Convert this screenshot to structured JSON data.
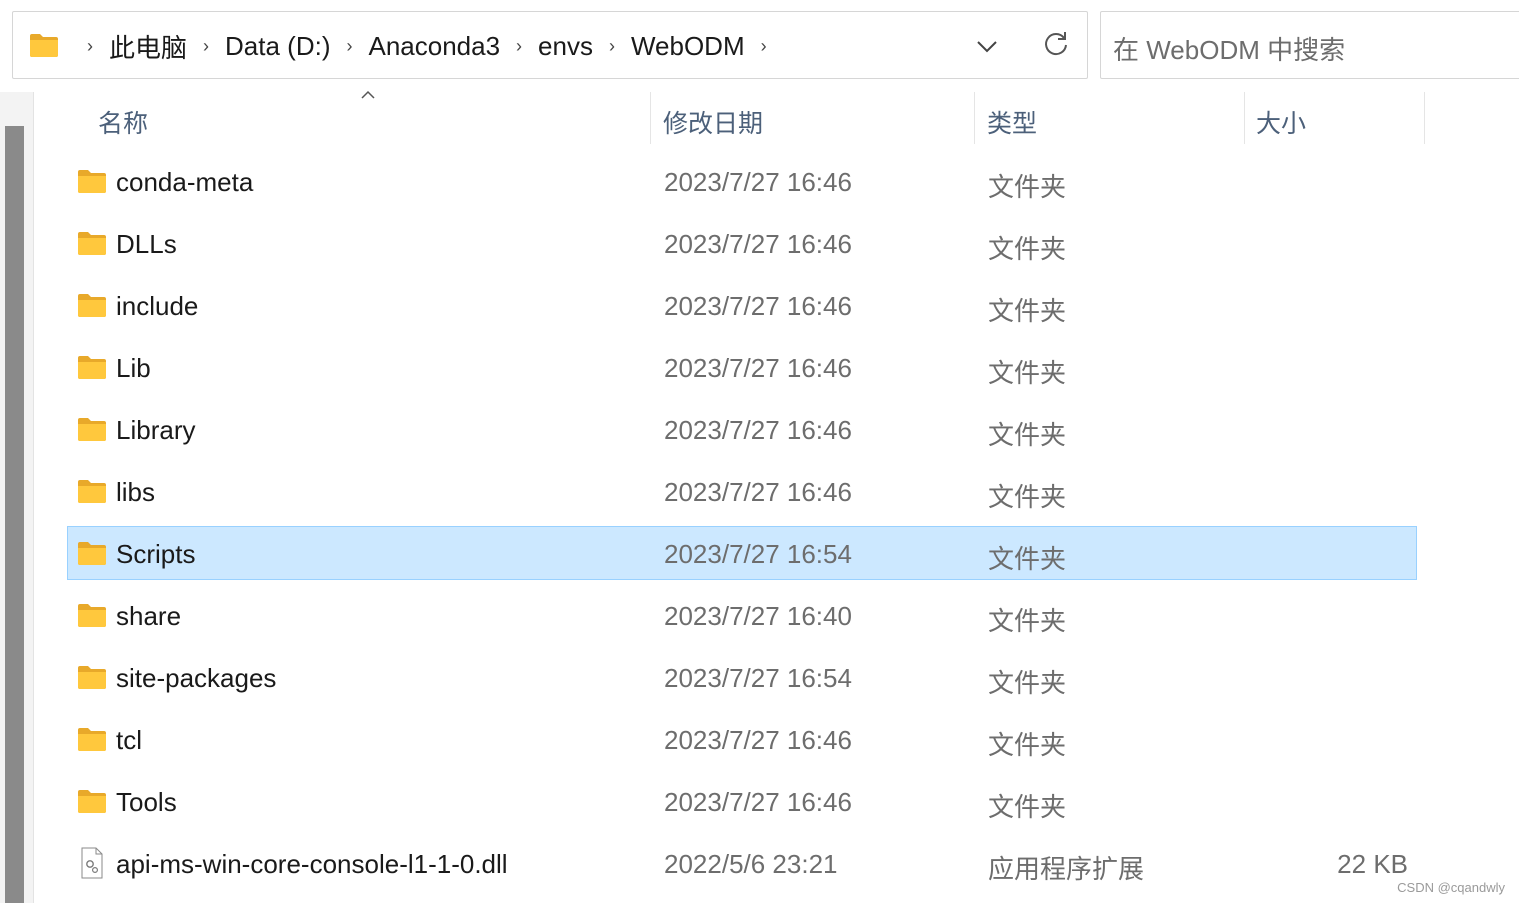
{
  "address_bar": {
    "crumbs": [
      "此电脑",
      "Data (D:)",
      "Anaconda3",
      "envs",
      "WebODM"
    ]
  },
  "search": {
    "placeholder": "在 WebODM 中搜索"
  },
  "columns": {
    "name": "名称",
    "date": "修改日期",
    "type": "类型",
    "size": "大小"
  },
  "rows": [
    {
      "name": "conda-meta",
      "date": "2023/7/27 16:46",
      "type": "文件夹",
      "size": "",
      "icon": "folder-icon"
    },
    {
      "name": "DLLs",
      "date": "2023/7/27 16:46",
      "type": "文件夹",
      "size": "",
      "icon": "folder-icon"
    },
    {
      "name": "include",
      "date": "2023/7/27 16:46",
      "type": "文件夹",
      "size": "",
      "icon": "folder-icon"
    },
    {
      "name": "Lib",
      "date": "2023/7/27 16:46",
      "type": "文件夹",
      "size": "",
      "icon": "folder-icon"
    },
    {
      "name": "Library",
      "date": "2023/7/27 16:46",
      "type": "文件夹",
      "size": "",
      "icon": "folder-icon"
    },
    {
      "name": "libs",
      "date": "2023/7/27 16:46",
      "type": "文件夹",
      "size": "",
      "icon": "folder-icon"
    },
    {
      "name": "Scripts",
      "date": "2023/7/27 16:54",
      "type": "文件夹",
      "size": "",
      "icon": "folder-icon"
    },
    {
      "name": "share",
      "date": "2023/7/27 16:40",
      "type": "文件夹",
      "size": "",
      "icon": "folder-icon"
    },
    {
      "name": "site-packages",
      "date": "2023/7/27 16:54",
      "type": "文件夹",
      "size": "",
      "icon": "folder-icon"
    },
    {
      "name": "tcl",
      "date": "2023/7/27 16:46",
      "type": "文件夹",
      "size": "",
      "icon": "folder-icon"
    },
    {
      "name": "Tools",
      "date": "2023/7/27 16:46",
      "type": "文件夹",
      "size": "",
      "icon": "folder-icon"
    },
    {
      "name": "api-ms-win-core-console-l1-1-0.dll",
      "date": "2022/5/6 23:21",
      "type": "应用程序扩展",
      "size": "22 KB",
      "icon": "dll-file-icon"
    }
  ],
  "selected_row": "Scripts",
  "watermark": "CSDN @cqandwly",
  "colors": {
    "selection_bg": "#cce8ff",
    "selection_border": "#99d1ff",
    "folder": "#ffc83d"
  }
}
